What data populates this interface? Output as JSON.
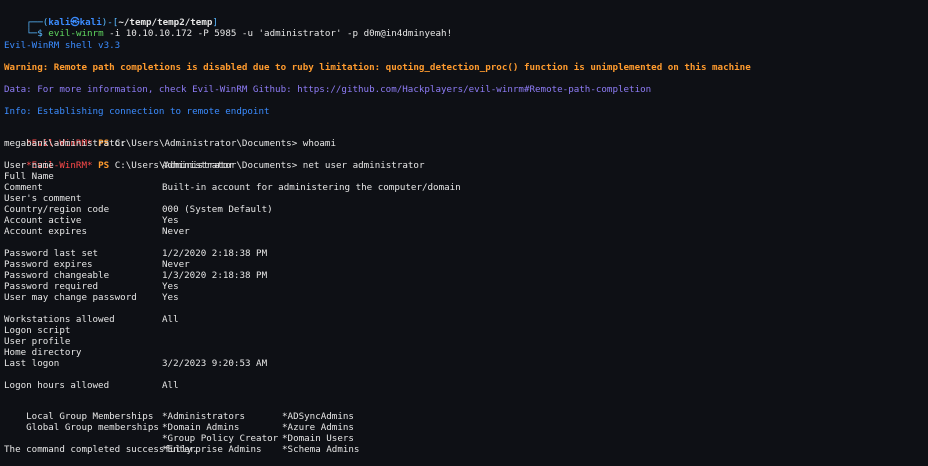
{
  "colors": {
    "background": "#0e1015",
    "prompt_blue": "#3b8cff",
    "prompt_cyan": "#58b8ff",
    "warning_orange": "#ff9b2e",
    "evil_red": "#ff4a4a",
    "info_purple": "#8e7cf6"
  },
  "prompt": {
    "top": "┌──(",
    "user_host": "kali㉿kali",
    "mid": ")-[",
    "path": "~/temp/temp2/temp",
    "end": "]",
    "bottom": "└─$",
    "command_name": "evil-winrm",
    "command_args": " -i 10.10.10.172 -P 5985 -u 'administrator' -p d0m@in4dminyeah!"
  },
  "banner": {
    "shell_version": "Evil-WinRM shell v3.3",
    "warning": "Warning: Remote path completions is disabled due to ruby limitation: quoting_detection_proc() function is unimplemented on this machine",
    "data_line": "Data: For more information, check Evil-WinRM Github: https://github.com/Hackplayers/evil-winrm#Remote-path-completion",
    "info_line": "Info: Establishing connection to remote endpoint"
  },
  "session": {
    "evil_prompt": "*Evil-WinRM*",
    "ps": "PS",
    "cwd": "C:\\Users\\Administrator\\Documents>",
    "cmd1": "whoami",
    "cmd1_output": "megabank\\administrator",
    "cmd2": "net user administrator"
  },
  "user_info": [
    {
      "label": "User name",
      "value": "Administrator"
    },
    {
      "label": "Full Name",
      "value": ""
    },
    {
      "label": "Comment",
      "value": "Built-in account for administering the computer/domain"
    },
    {
      "label": "User's comment",
      "value": ""
    },
    {
      "label": "Country/region code",
      "value": "000 (System Default)"
    },
    {
      "label": "Account active",
      "value": "Yes"
    },
    {
      "label": "Account expires",
      "value": "Never"
    },
    {
      "label": "",
      "value": ""
    },
    {
      "label": "Password last set",
      "value": "1/2/2020 2:18:38 PM"
    },
    {
      "label": "Password expires",
      "value": "Never"
    },
    {
      "label": "Password changeable",
      "value": "1/3/2020 2:18:38 PM"
    },
    {
      "label": "Password required",
      "value": "Yes"
    },
    {
      "label": "User may change password",
      "value": "Yes"
    },
    {
      "label": "",
      "value": ""
    },
    {
      "label": "Workstations allowed",
      "value": "All"
    },
    {
      "label": "Logon script",
      "value": ""
    },
    {
      "label": "User profile",
      "value": ""
    },
    {
      "label": "Home directory",
      "value": ""
    },
    {
      "label": "Last logon",
      "value": "3/2/2023 9:20:53 AM"
    },
    {
      "label": "",
      "value": ""
    },
    {
      "label": "Logon hours allowed",
      "value": "All"
    }
  ],
  "groups": {
    "local_label": "Local Group Memberships",
    "global_label": "Global Group memberships",
    "local": [
      "*Administrators",
      "*ADSyncAdmins"
    ],
    "global": [
      [
        "*Domain Admins",
        "*Azure Admins"
      ],
      [
        "*Group Policy Creator",
        "*Domain Users"
      ],
      [
        "*Enterprise Admins",
        "*Schema Admins"
      ]
    ]
  },
  "completion": "The command completed successfully."
}
